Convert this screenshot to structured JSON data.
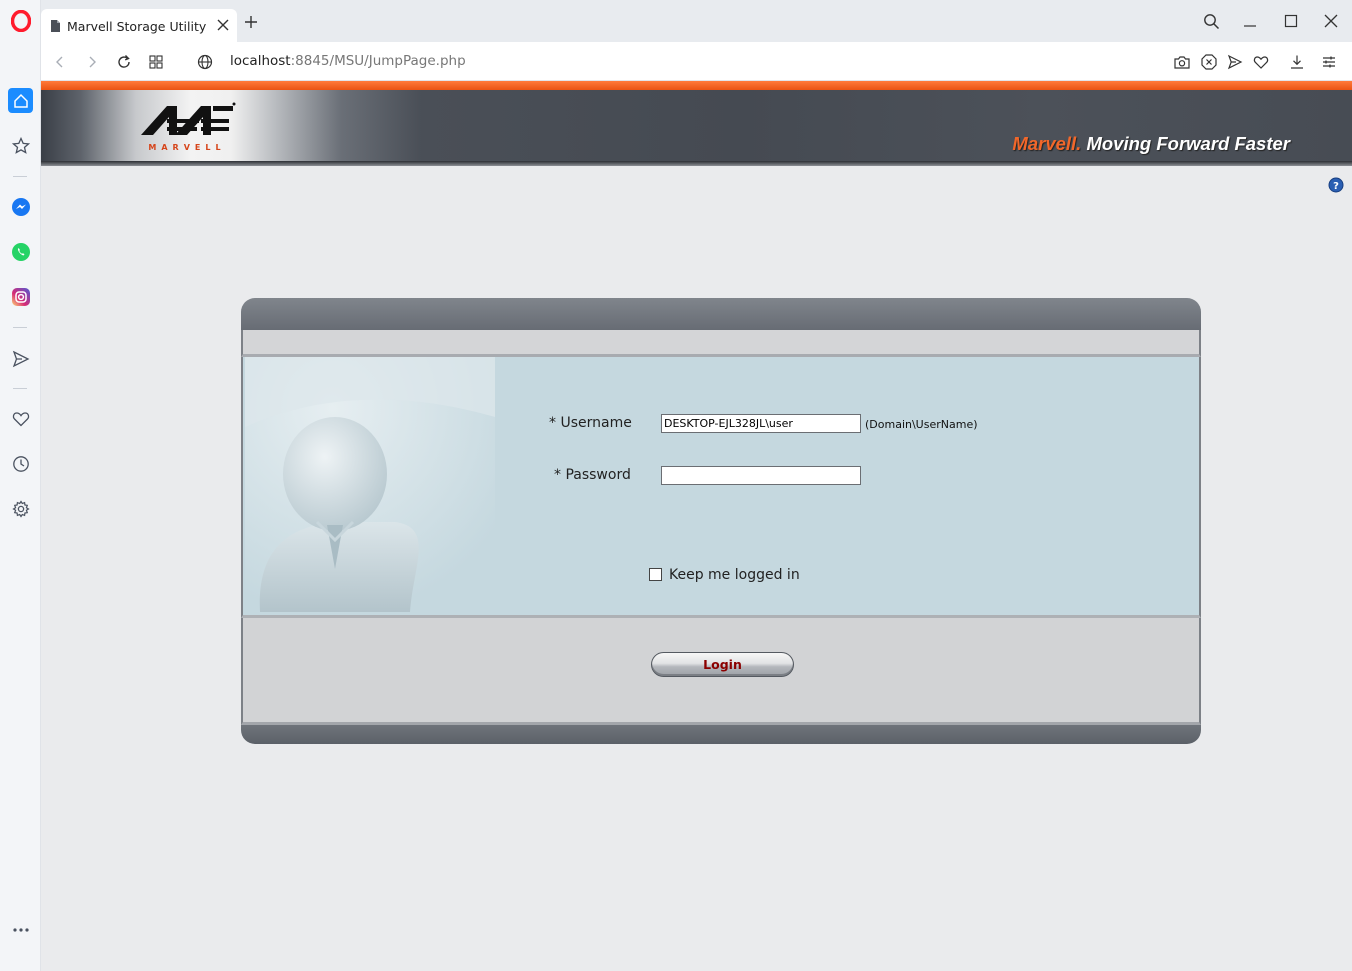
{
  "browser": {
    "tab_title": "Marvell Storage Utility",
    "url_host": "localhost",
    "url_path": ":8845/MSU/JumpPage.php",
    "sidebar_icons": [
      "opera-logo-icon",
      "home-icon",
      "bookmarks-icon",
      "messenger-icon",
      "whatsapp-icon",
      "instagram-icon",
      "send-icon",
      "heart-icon",
      "history-icon",
      "settings-icon",
      "more-icon"
    ],
    "toolbar_icons": [
      "camera-icon",
      "adblock-icon",
      "send-icon",
      "heart-icon",
      "download-icon",
      "easy-setup-icon"
    ]
  },
  "header": {
    "logo_text": "MARVELL",
    "tagline_brand": "Marvell.",
    "tagline_slogan": " Moving Forward Faster"
  },
  "login": {
    "username_label": "* Username",
    "username_value": "DESKTOP-EJL328JL\\user",
    "username_hint": "(Domain\\UserName)",
    "password_label": "* Password",
    "password_value": "",
    "keep_logged_in_label": "Keep me logged in",
    "keep_logged_in_checked": false,
    "login_button_label": "Login"
  },
  "colors": {
    "accent_orange": "#ea5413",
    "login_text": "#8b0000",
    "panel_body": "#c5d8df"
  }
}
